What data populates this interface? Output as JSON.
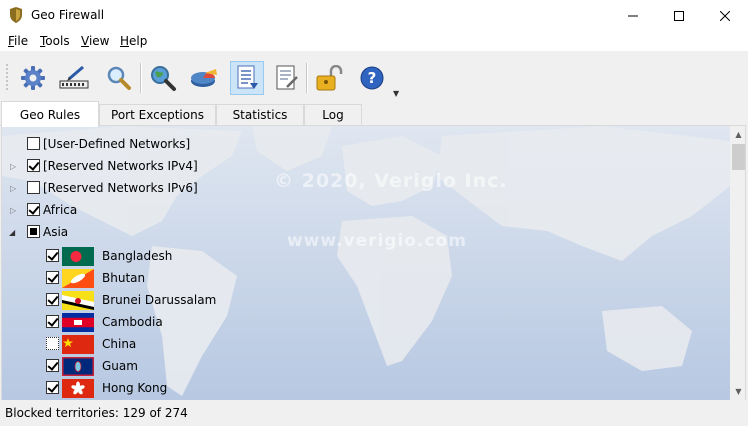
{
  "window": {
    "title": "Geo Firewall",
    "minimize_icon": "minimize-icon",
    "maximize_icon": "maximize-icon",
    "close_icon": "close-icon"
  },
  "menu": [
    {
      "label": "File",
      "mnemonic": "F",
      "rest": "ile"
    },
    {
      "label": "Tools",
      "mnemonic": "T",
      "rest": "ools"
    },
    {
      "label": "View",
      "mnemonic": "V",
      "rest": "iew"
    },
    {
      "label": "Help",
      "mnemonic": "H",
      "rest": "elp"
    }
  ],
  "toolbar": {
    "buttons": [
      {
        "icon": "gear-icon"
      },
      {
        "icon": "network-edit-icon"
      },
      {
        "icon": "magnifier-icon"
      },
      {
        "icon": "globe-search-icon"
      },
      {
        "icon": "pie-chart-icon"
      },
      {
        "icon": "log-list-icon",
        "pressed": true
      },
      {
        "icon": "document-edit-icon"
      },
      {
        "icon": "unlock-icon"
      },
      {
        "icon": "help-icon"
      }
    ]
  },
  "tabs": [
    {
      "label": "Geo Rules",
      "active": true
    },
    {
      "label": "Port Exceptions",
      "active": false
    },
    {
      "label": "Statistics",
      "active": false
    },
    {
      "label": "Log",
      "active": false
    }
  ],
  "watermark": {
    "line1": "© 2020, Verigio Inc.",
    "line2": "www.verigio.com"
  },
  "tree": [
    {
      "label": "[User-Defined Networks]",
      "state": "unchecked",
      "expander": "none",
      "level": 0
    },
    {
      "label": "[Reserved Networks IPv4]",
      "state": "checked",
      "expander": "collapsed",
      "level": 0
    },
    {
      "label": "[Reserved Networks IPv6]",
      "state": "unchecked",
      "expander": "collapsed",
      "level": 0
    },
    {
      "label": "Africa",
      "state": "checked",
      "expander": "collapsed",
      "level": 0
    },
    {
      "label": "Asia",
      "state": "partial",
      "expander": "expanded",
      "level": 0
    },
    {
      "label": "Bangladesh",
      "state": "checked",
      "level": 1,
      "flag": "bangladesh"
    },
    {
      "label": "Bhutan",
      "state": "checked",
      "level": 1,
      "flag": "bhutan"
    },
    {
      "label": "Brunei Darussalam",
      "state": "checked",
      "level": 1,
      "flag": "brunei"
    },
    {
      "label": "Cambodia",
      "state": "checked",
      "level": 1,
      "flag": "cambodia"
    },
    {
      "label": "China",
      "state": "focus",
      "level": 1,
      "flag": "china"
    },
    {
      "label": "Guam",
      "state": "checked",
      "level": 1,
      "flag": "guam"
    },
    {
      "label": "Hong Kong",
      "state": "checked",
      "level": 1,
      "flag": "hongkong"
    }
  ],
  "status": {
    "text": "Blocked territories: 129 of 274"
  },
  "colors": {
    "map_ocean": "#c9d7ea",
    "map_land": "#dfe4ea",
    "pressed_button": "#cce4f7"
  }
}
